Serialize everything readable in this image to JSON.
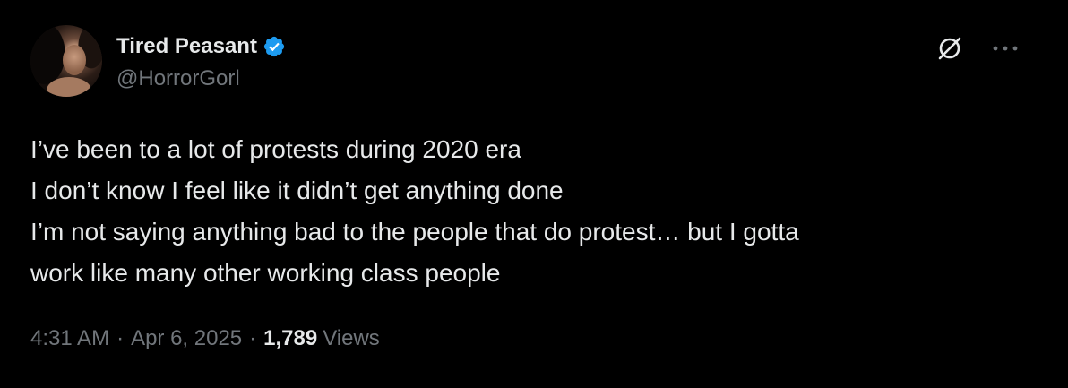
{
  "user": {
    "display_name": "Tired Peasant",
    "handle": "@HorrorGorl",
    "verified": true,
    "verified_icon": "verified-badge-icon",
    "avatar": "profile-photo"
  },
  "actions": {
    "grok_icon": "grok-icon",
    "more_icon": "more-options-icon"
  },
  "tweet": {
    "lines": [
      "I’ve been to a lot of protests during 2020 era",
      "I don’t know I feel like it didn’t get anything done",
      "I’m not saying anything bad to the people that do protest… but I gotta",
      "work like many other working class people"
    ]
  },
  "meta": {
    "time": "4:31 AM",
    "separator": "·",
    "date": "Apr 6, 2025",
    "views_count": "1,789",
    "views_label": "Views"
  },
  "colors": {
    "background": "#000000",
    "primary_text": "#e7e9ea",
    "secondary_text": "#71767b",
    "verified_blue": "#1d9bf0"
  }
}
